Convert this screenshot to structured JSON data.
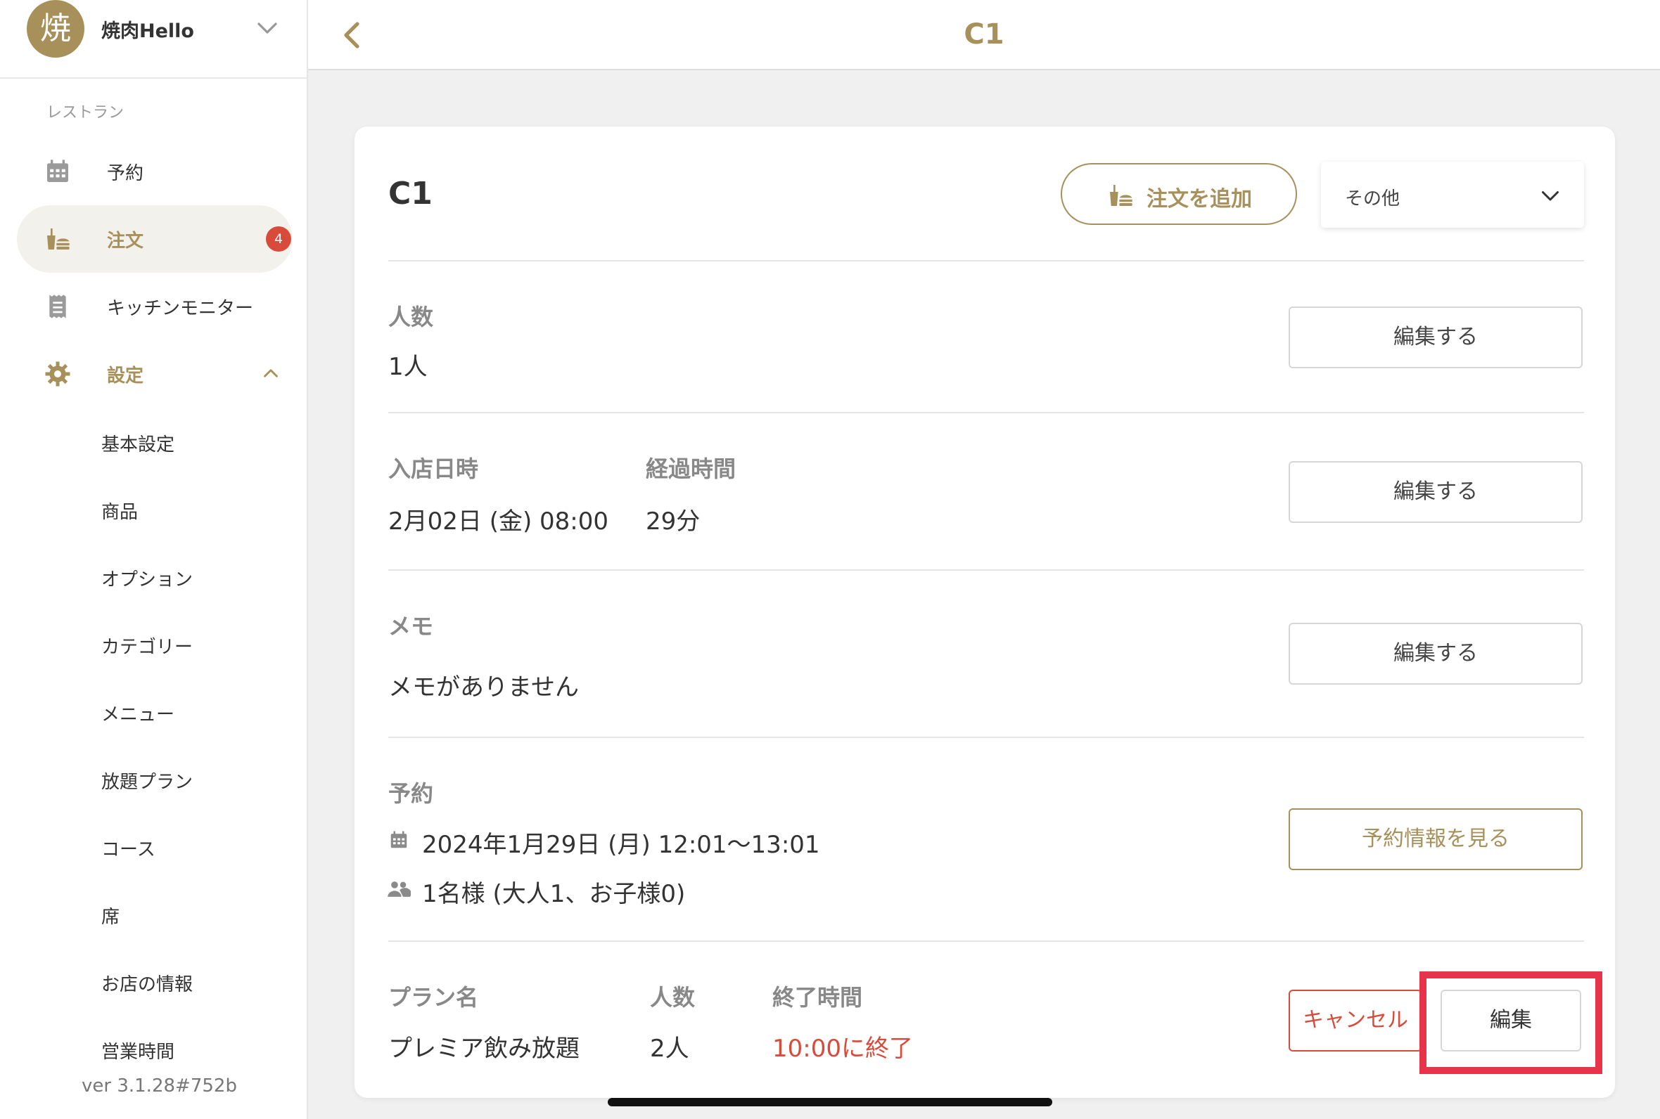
{
  "store": {
    "avatar_char": "焼",
    "name": "焼肉Hello"
  },
  "sidebar": {
    "section_label": "レストラン",
    "nav": {
      "reservation": "予約",
      "orders": "注文",
      "orders_badge": "4",
      "kitchen_monitor": "キッチンモニター",
      "settings": "設定"
    },
    "settings_items": [
      "基本設定",
      "商品",
      "オプション",
      "カテゴリー",
      "メニュー",
      "放題プラン",
      "コース",
      "席",
      "お店の情報",
      "営業時間"
    ],
    "version": "ver 3.1.28#752b"
  },
  "topbar": {
    "title": "C1"
  },
  "card": {
    "title": "C1",
    "add_order_label": "注文を追加",
    "other_select_label": "その他",
    "people": {
      "label": "人数",
      "value": "1人",
      "edit_label": "編集する"
    },
    "entry": {
      "entry_label": "入店日時",
      "entry_value": "2月02日 (金) 08:00",
      "elapsed_label": "経過時間",
      "elapsed_value": "29分",
      "edit_label": "編集する"
    },
    "memo": {
      "label": "メモ",
      "value": "メモがありません",
      "edit_label": "編集する"
    },
    "reservation": {
      "label": "予約",
      "datetime": "2024年1月29日 (月) 12:01〜13:01",
      "guests": "1名様 (大人1、お子様0)",
      "view_label": "予約情報を見る"
    },
    "plan": {
      "plan_label": "プラン名",
      "plan_value": "プレミア飲み放題",
      "people_label": "人数",
      "people_value": "2人",
      "end_label": "終了時間",
      "end_value": "10:00に終了",
      "cancel_label": "キャンセル",
      "edit_label": "編集"
    }
  },
  "colors": {
    "accent": "#a8905a",
    "danger": "#d84a3a",
    "highlight": "#e8344a"
  }
}
